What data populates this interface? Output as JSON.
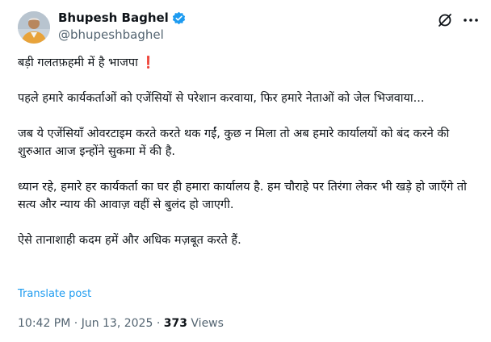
{
  "author": {
    "display_name": "Bhupesh Baghel",
    "handle": "@bhupeshbaghel",
    "verified": true,
    "avatar_icon": "avatar-photo"
  },
  "header_icons": {
    "grok": "grok-icon",
    "more": "more-dots-icon"
  },
  "post": {
    "paragraphs": [
      "बड़ी गलतफ़हमी में है भाजपा",
      "पहले हमारे कार्यकर्ताओं को एजेंसियों से परेशान करवाया, फिर हमारे नेताओं को जेल भिजवाया...",
      "जब ये एजेंसियाँ ओवरटाइम करते करते थक गईं, कुछ न मिला तो अब हमारे कार्यालयों को बंद करने की शुरुआत आज इन्होंने सुकमा में की है.",
      "ध्यान रहे, हमारे हर कार्यकर्ता का घर ही हमारा कार्यालय है. हम चौराहे पर तिरंगा लेकर भी खड़े हो जाएँगे तो सत्य और न्याय की आवाज़ वहीं से बुलंद हो जाएगी.",
      "ऐसे तानाशाही कदम हमें और अधिक मज़बूत करते हैं."
    ],
    "exclamation_emoji": "❗"
  },
  "translate_label": "Translate post",
  "meta": {
    "time": "10:42 PM",
    "separator": "·",
    "date": "Jun 13, 2025",
    "views_count": "373",
    "views_label": "Views"
  },
  "colors": {
    "text": "#0f1419",
    "secondary": "#536471",
    "link": "#1d9bf0",
    "verified": "#1d9bf0",
    "exclamation": "#e0245e"
  }
}
